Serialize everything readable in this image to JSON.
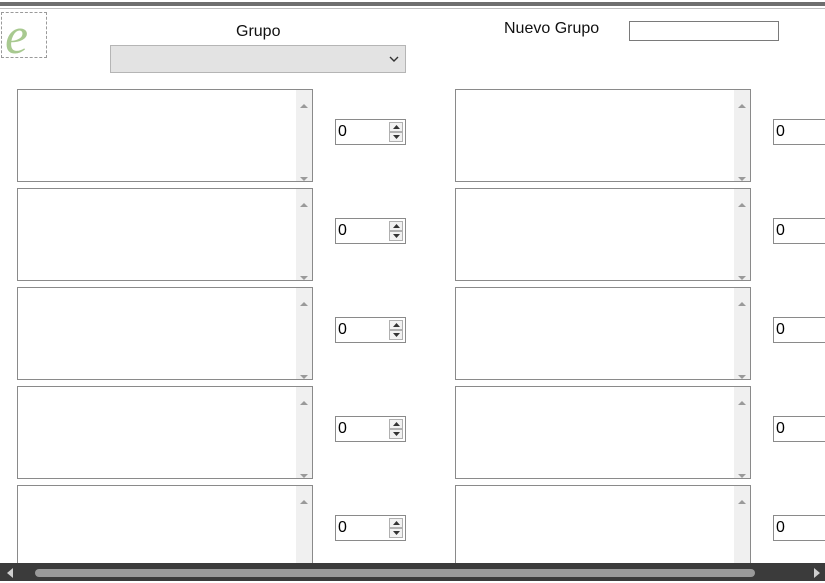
{
  "header": {
    "grupo_label": "Grupo",
    "grupo_selected": "",
    "nuevo_grupo_label": "Nuevo Grupo",
    "nuevo_grupo_value": ""
  },
  "logo": {
    "letter": "e",
    "color": "#a8c990"
  },
  "rows_left": [
    {
      "text": "",
      "value": "0"
    },
    {
      "text": "",
      "value": "0"
    },
    {
      "text": "",
      "value": "0"
    },
    {
      "text": "",
      "value": "0"
    },
    {
      "text": "",
      "value": "0"
    }
  ],
  "rows_right": [
    {
      "text": "",
      "value": "0"
    },
    {
      "text": "",
      "value": "0"
    },
    {
      "text": "",
      "value": "0"
    },
    {
      "text": "",
      "value": "0"
    },
    {
      "text": "",
      "value": "0"
    }
  ]
}
